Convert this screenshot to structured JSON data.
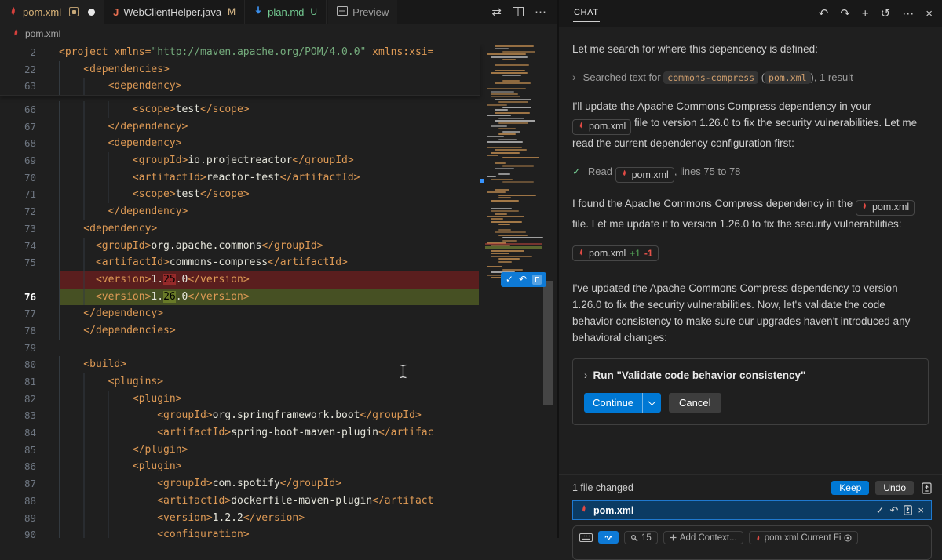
{
  "colors": {
    "accent_blue": "#0078d4",
    "maven_red": "#d6403c",
    "untracked_green": "#73c991",
    "modified_gold": "#e2c08d",
    "deleted_line_bg": "#5a1e1e",
    "added_line_bg": "#465023"
  },
  "editor": {
    "tabs": [
      {
        "label": "pom.xml",
        "icon": "maven-icon",
        "color": "#dcb67a",
        "active": true,
        "pinned_box": true,
        "dirty": true
      },
      {
        "label": "WebClientHelper.java",
        "icon": "java-icon",
        "color": "#d6d6d6",
        "badge": "M",
        "badge_color": "#e2c08d"
      },
      {
        "label": "plan.md",
        "icon": "markdown-down-icon",
        "color": "#73c991",
        "badge": "U",
        "badge_color": "#73c991"
      },
      {
        "label": "Preview",
        "icon": "preview-icon",
        "color": "#9d9d9d",
        "preview": true
      }
    ],
    "tab_action_icons": {
      "compare": "⇄",
      "split": "split-editor",
      "more": "⋯"
    },
    "breadcrumb": "pom.xml",
    "sticky_lines": [
      {
        "n": "2",
        "ind": 0,
        "segs": [
          [
            "tag",
            "<project xmlns="
          ],
          [
            "str",
            "\""
          ],
          [
            "lnk",
            "http://maven.apache.org/POM/4.0.0"
          ],
          [
            "str",
            "\""
          ],
          [
            "tag",
            " xmlns:xsi="
          ]
        ]
      },
      {
        "n": "22",
        "ind": 4,
        "segs": [
          [
            "tag",
            "<dependencies>"
          ]
        ]
      },
      {
        "n": "63",
        "ind": 8,
        "segs": [
          [
            "tag",
            "<dependency>"
          ]
        ]
      }
    ],
    "lines": [
      {
        "n": "66",
        "ind": 12,
        "segs": [
          [
            "tag",
            "<scope>"
          ],
          [
            "txt",
            "test"
          ],
          [
            "tag",
            "</scope>"
          ]
        ]
      },
      {
        "n": "67",
        "ind": 8,
        "segs": [
          [
            "tag",
            "</dependency>"
          ]
        ]
      },
      {
        "n": "68",
        "ind": 8,
        "segs": [
          [
            "tag",
            "<dependency>"
          ]
        ]
      },
      {
        "n": "69",
        "ind": 12,
        "segs": [
          [
            "tag",
            "<groupId>"
          ],
          [
            "txt",
            "io.projectreactor"
          ],
          [
            "tag",
            "</groupId>"
          ]
        ]
      },
      {
        "n": "70",
        "ind": 12,
        "segs": [
          [
            "tag",
            "<artifactId>"
          ],
          [
            "txt",
            "reactor-test"
          ],
          [
            "tag",
            "</artifactId>"
          ]
        ]
      },
      {
        "n": "71",
        "ind": 12,
        "segs": [
          [
            "tag",
            "<scope>"
          ],
          [
            "txt",
            "test"
          ],
          [
            "tag",
            "</scope>"
          ]
        ]
      },
      {
        "n": "72",
        "ind": 8,
        "segs": [
          [
            "tag",
            "</dependency>"
          ]
        ]
      },
      {
        "n": "73",
        "ind": 4,
        "segs": [
          [
            "tag",
            "<dependency>"
          ]
        ]
      },
      {
        "n": "74",
        "ind": 6,
        "segs": [
          [
            "tag",
            "<groupId>"
          ],
          [
            "txt",
            "org.apache.commons"
          ],
          [
            "tag",
            "</groupId>"
          ]
        ]
      },
      {
        "n": "75",
        "ind": 6,
        "segs": [
          [
            "tag",
            "<artifactId>"
          ],
          [
            "txt",
            "commons-compress"
          ],
          [
            "tag",
            "</artifactId>"
          ]
        ]
      },
      {
        "n": "",
        "ind": 6,
        "cls": "del",
        "badge": true,
        "segs": [
          [
            "tag",
            "<version>"
          ],
          [
            "txt",
            "1."
          ],
          [
            "del",
            "25"
          ],
          [
            "txt",
            ".0"
          ],
          [
            "tag",
            "</version>"
          ]
        ]
      },
      {
        "n": "76",
        "ind": 6,
        "cls": "add",
        "segs": [
          [
            "tag",
            "<version>"
          ],
          [
            "txt",
            "1."
          ],
          [
            "add",
            "26"
          ],
          [
            "txt",
            ".0"
          ],
          [
            "tag",
            "</version>"
          ]
        ]
      },
      {
        "n": "77",
        "ind": 4,
        "segs": [
          [
            "tag",
            "</dependency>"
          ]
        ]
      },
      {
        "n": "78",
        "ind": 4,
        "segs": [
          [
            "tag",
            "</dependencies>"
          ]
        ]
      },
      {
        "n": "79",
        "ind": 0,
        "segs": []
      },
      {
        "n": "80",
        "ind": 4,
        "segs": [
          [
            "tag",
            "<build>"
          ]
        ]
      },
      {
        "n": "81",
        "ind": 8,
        "segs": [
          [
            "tag",
            "<plugins>"
          ]
        ]
      },
      {
        "n": "82",
        "ind": 12,
        "segs": [
          [
            "tag",
            "<plugin>"
          ]
        ]
      },
      {
        "n": "83",
        "ind": 16,
        "segs": [
          [
            "tag",
            "<groupId>"
          ],
          [
            "txt",
            "org.springframework.boot"
          ],
          [
            "tag",
            "</groupId>"
          ]
        ]
      },
      {
        "n": "84",
        "ind": 16,
        "segs": [
          [
            "tag",
            "<artifactId>"
          ],
          [
            "txt",
            "spring-boot-maven-plugin"
          ],
          [
            "tag",
            "</artifac"
          ]
        ]
      },
      {
        "n": "85",
        "ind": 12,
        "segs": [
          [
            "tag",
            "</plugin>"
          ]
        ]
      },
      {
        "n": "86",
        "ind": 12,
        "segs": [
          [
            "tag",
            "<plugin>"
          ]
        ]
      },
      {
        "n": "87",
        "ind": 16,
        "segs": [
          [
            "tag",
            "<groupId>"
          ],
          [
            "txt",
            "com.spotify"
          ],
          [
            "tag",
            "</groupId>"
          ]
        ]
      },
      {
        "n": "88",
        "ind": 16,
        "segs": [
          [
            "tag",
            "<artifactId>"
          ],
          [
            "txt",
            "dockerfile-maven-plugin"
          ],
          [
            "tag",
            "</artifact"
          ]
        ]
      },
      {
        "n": "89",
        "ind": 16,
        "segs": [
          [
            "tag",
            "<version>"
          ],
          [
            "txt",
            "1.2.2"
          ],
          [
            "tag",
            "</version>"
          ]
        ]
      },
      {
        "n": "90",
        "ind": 16,
        "segs": [
          [
            "tag",
            "<configuration>"
          ]
        ]
      }
    ],
    "diff_action_icons": {
      "accept": "✓",
      "discard": "↶",
      "open_changes": "doc"
    }
  },
  "chat": {
    "title": "CHAT",
    "header_icons": [
      {
        "name": "undo-icon",
        "glyph": "↶"
      },
      {
        "name": "redo-icon",
        "glyph": "↷"
      },
      {
        "name": "new-chat-icon",
        "glyph": "+"
      },
      {
        "name": "history-icon",
        "glyph": "↺"
      },
      {
        "name": "more-icon",
        "glyph": "⋯"
      },
      {
        "name": "close-icon",
        "glyph": "×"
      }
    ],
    "blocks": [
      {
        "type": "text",
        "runs": [
          [
            "t",
            "Let me search for where this dependency is defined:"
          ]
        ]
      },
      {
        "type": "tool",
        "icon": "chevron",
        "runs": [
          [
            "t",
            "Searched text for "
          ],
          [
            "code",
            "commons-compress"
          ],
          [
            "t",
            " ("
          ],
          [
            "code",
            "pom.xml"
          ],
          [
            "t",
            "), 1 result"
          ]
        ]
      },
      {
        "type": "text",
        "runs": [
          [
            "t",
            "I'll update the Apache Commons Compress dependency in your "
          ],
          [
            "file",
            "pom.xml"
          ],
          [
            "t",
            " file to version 1.26.0 to fix the security vulnerabilities. Let me read the current dependency configuration first:"
          ]
        ]
      },
      {
        "type": "tool",
        "icon": "check",
        "runs": [
          [
            "t",
            "Read "
          ],
          [
            "file",
            "pom.xml"
          ],
          [
            "t",
            ", lines 75 to 78"
          ]
        ]
      },
      {
        "type": "text",
        "runs": [
          [
            "t",
            "I found the Apache Commons Compress dependency in the "
          ],
          [
            "file",
            "pom.xml"
          ],
          [
            "t",
            " file. Let me update it to version 1.26.0 to fix the security vulnerabilities:"
          ]
        ]
      },
      {
        "type": "diffchip",
        "file": "pom.xml",
        "plus": "+1",
        "minus": "-1"
      },
      {
        "type": "text",
        "runs": [
          [
            "t",
            "I've updated the Apache Commons Compress dependency to version 1.26.0 to fix the security vulnerabilities. Now, let's validate the code behavior consistency to make sure our upgrades haven't introduced any behavioral changes:"
          ]
        ]
      },
      {
        "type": "runbox",
        "title": "Run \"Validate code behavior consistency\"",
        "continue_label": "Continue",
        "cancel_label": "Cancel"
      }
    ],
    "changes": {
      "summary": "1 file changed",
      "keep_label": "Keep",
      "undo_label": "Undo",
      "file_name": "pom.xml"
    },
    "input": {
      "tools_count": "15",
      "add_context": "Add Context...",
      "attached": "pom.xml Current Fi"
    }
  }
}
